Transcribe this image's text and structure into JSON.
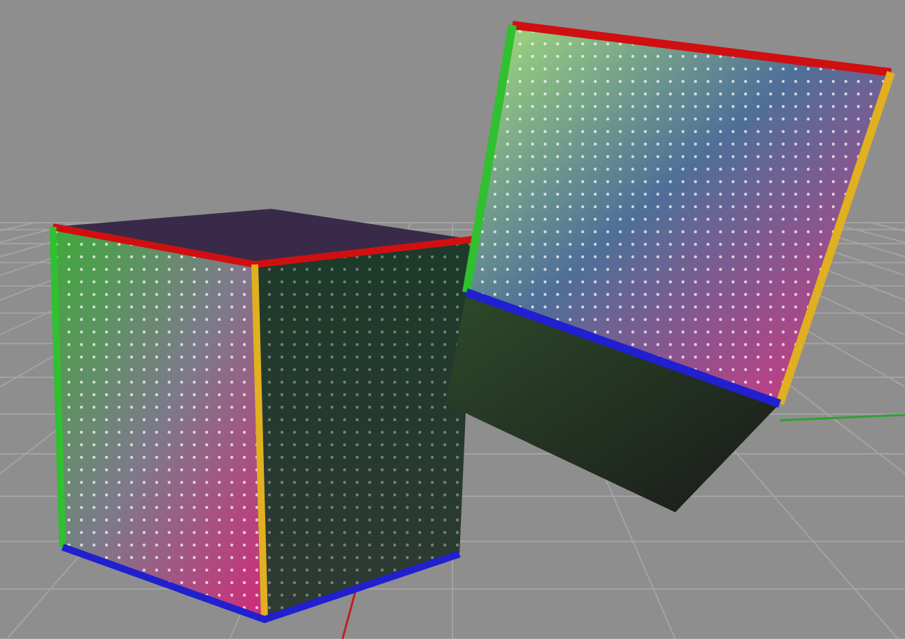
{
  "viewport": {
    "grid": true,
    "objects": [
      {
        "kind": "cube"
      },
      {
        "kind": "tilted-cube"
      }
    ]
  }
}
